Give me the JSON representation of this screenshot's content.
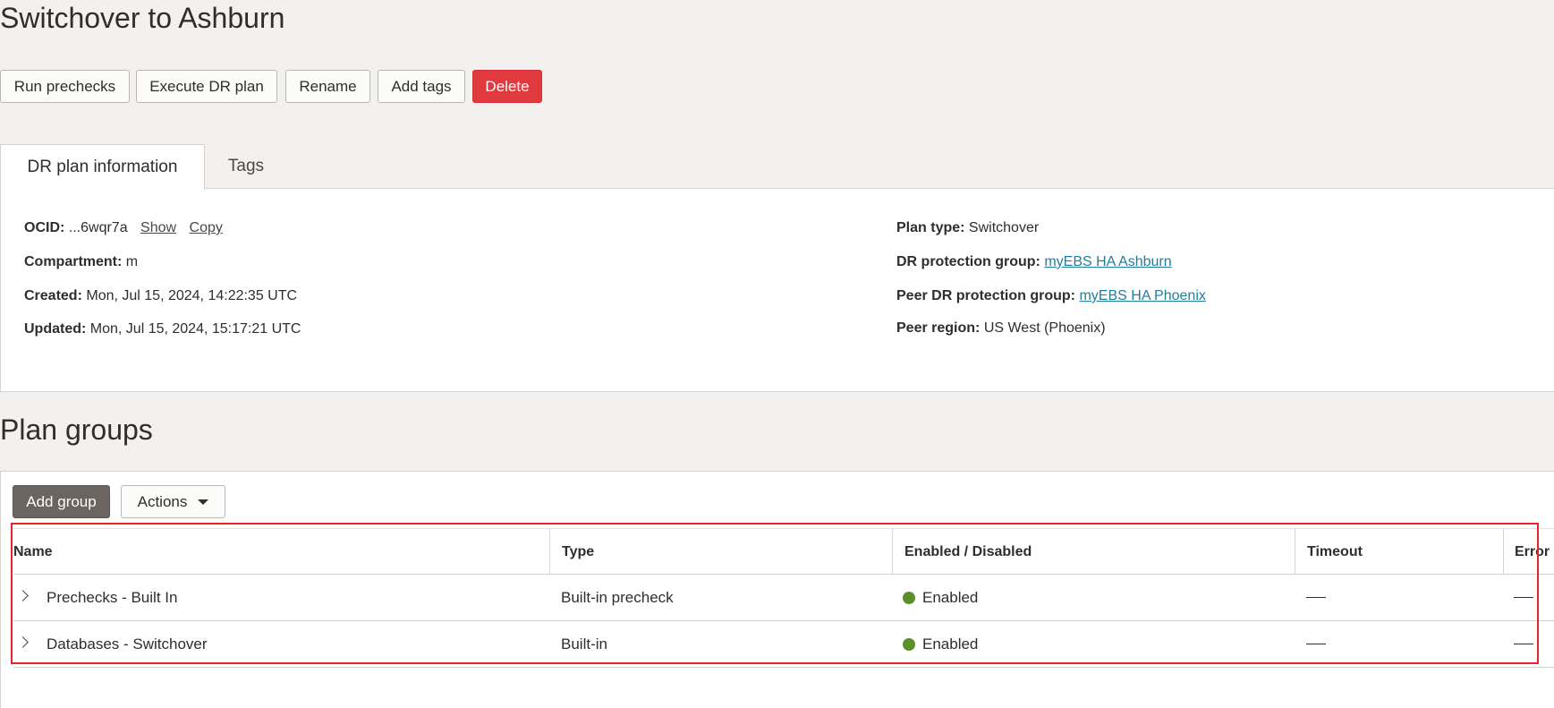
{
  "page": {
    "title": "Switchover to Ashburn"
  },
  "toolbar": {
    "run_prechecks": "Run prechecks",
    "execute_dr_plan": "Execute DR plan",
    "rename": "Rename",
    "add_tags": "Add tags",
    "delete": "Delete"
  },
  "tabs": {
    "dr_plan_information": "DR plan information",
    "tags": "Tags"
  },
  "info": {
    "ocid_label": "OCID:",
    "ocid_value": "...6wqr7a",
    "ocid_show": "Show",
    "ocid_copy": "Copy",
    "compartment_label": "Compartment:",
    "compartment_value": "m",
    "created_label": "Created:",
    "created_value": "Mon, Jul 15, 2024, 14:22:35 UTC",
    "updated_label": "Updated:",
    "updated_value": "Mon, Jul 15, 2024, 15:17:21 UTC",
    "plan_type_label": "Plan type:",
    "plan_type_value": "Switchover",
    "dr_group_label": "DR protection group:",
    "dr_group_value": "myEBS HA Ashburn",
    "peer_group_label": "Peer DR protection group:",
    "peer_group_value": "myEBS HA Phoenix",
    "peer_region_label": "Peer region:",
    "peer_region_value": "US West (Phoenix)"
  },
  "plan_groups": {
    "title": "Plan groups",
    "add_group": "Add group",
    "actions": "Actions",
    "columns": {
      "name": "Name",
      "type": "Type",
      "enabled": "Enabled / Disabled",
      "timeout": "Timeout",
      "error": "Error"
    },
    "rows": [
      {
        "name": "Prechecks - Built In",
        "type": "Built-in precheck",
        "status": "Enabled"
      },
      {
        "name": "Databases - Switchover",
        "type": "Built-in",
        "status": "Enabled"
      }
    ]
  },
  "colors": {
    "enabled_dot": "#5a8f29",
    "danger": "#e0393e",
    "link": "#227e9e",
    "highlight": "#e3262c"
  },
  "icons": {
    "row_expand": "chevron-right-icon",
    "status": "status-dot-icon",
    "actions_menu": "caret-down-icon"
  }
}
